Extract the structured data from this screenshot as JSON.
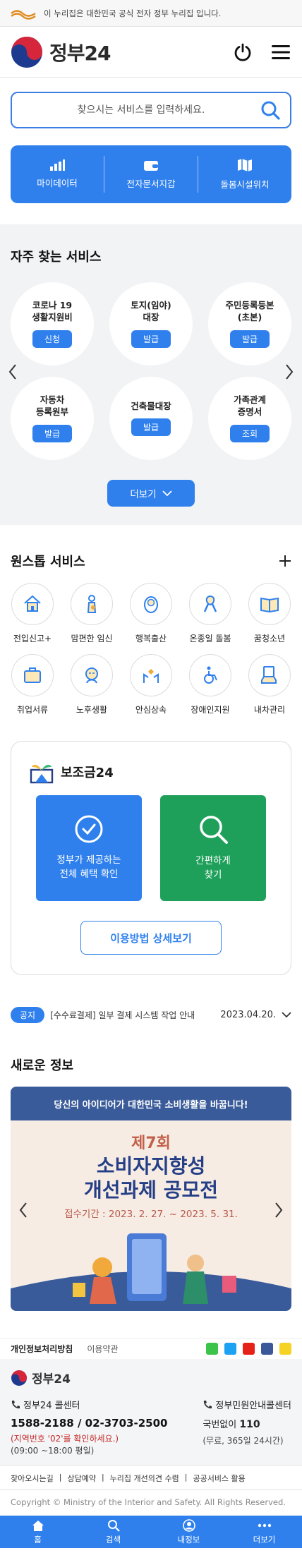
{
  "banner": {
    "text": "이 누리집은 대한민국 공식 전자 정부 누리집 입니다."
  },
  "header": {
    "logo_text": "정부24"
  },
  "search": {
    "placeholder": "찾으시는 서비스를 입력하세요."
  },
  "quick": [
    {
      "label": "마이데이터",
      "icon": "chart-icon"
    },
    {
      "label": "전자문서지갑",
      "icon": "wallet-icon"
    },
    {
      "label": "돌봄시설위치",
      "icon": "map-icon"
    }
  ],
  "frequent": {
    "title": "자주 찾는 서비스",
    "items": [
      {
        "name": "코로나 19\n생활지원비",
        "action": "신청"
      },
      {
        "name": "토지(임야)\n대장",
        "action": "발급"
      },
      {
        "name": "주민등록등본\n(초본)",
        "action": "발급"
      },
      {
        "name": "자동차\n등록원부",
        "action": "발급"
      },
      {
        "name": "건축물대장",
        "action": "발급"
      },
      {
        "name": "가족관계\n증명서",
        "action": "조회"
      }
    ],
    "more_label": "더보기"
  },
  "onestop": {
    "title": "원스톱 서비스",
    "items": [
      {
        "label": "전입신고+",
        "icon": "house-icon"
      },
      {
        "label": "맘편한 임신",
        "icon": "pregnancy-icon"
      },
      {
        "label": "행복출산",
        "icon": "baby-icon"
      },
      {
        "label": "온종일 돌봄",
        "icon": "ribbon-icon"
      },
      {
        "label": "꿈청소년",
        "icon": "book-icon"
      },
      {
        "label": "취업서류",
        "icon": "briefcase-icon"
      },
      {
        "label": "노후생활",
        "icon": "elder-icon"
      },
      {
        "label": "안심상속",
        "icon": "hands-icon"
      },
      {
        "label": "장애인지원",
        "icon": "wheelchair-icon"
      },
      {
        "label": "내차관리",
        "icon": "car-icon"
      }
    ]
  },
  "subsidy": {
    "title": "보조금24",
    "card1": "정부가 제공하는\n전체 혜택 확인",
    "card2": "간편하게\n찾기",
    "guide": "이용방법 상세보기"
  },
  "notice": {
    "badge": "공지",
    "text": "[수수료결제] 일부 결제 시스템 작업 안내",
    "date": "2023.04.20."
  },
  "news": {
    "title": "새로운 정보",
    "banner_top": "당신의 아이디어가 대한민국 소비생활을 바꿉니다!",
    "banner_small": "제7회",
    "banner_big": "소비자지향성\n개선과제 공모전",
    "banner_date": "접수기간 : 2023. 2. 27. ~ 2023. 5. 31."
  },
  "footer": {
    "privacy": "개인정보처리방침",
    "terms": "이용약관",
    "logo_text": "정부24",
    "call_center": "정부24 콜센터",
    "call_numbers": "1588-2188 / 02-3703-2500",
    "area_note": "(지역번호 '02'를 확인하세요.)",
    "hours": "(09:00 ~18:00 평일)",
    "info_center": "정부민원안내콜센터",
    "info_prefix": "국번없이",
    "info_number": "110",
    "info_hours": "(무료, 365일 24시간)",
    "links": [
      "찾아오시는길",
      "상담예약",
      "누리집 개선의견 수렴",
      "공공서비스 활용"
    ],
    "copyright": "Copyright © Ministry of the Interior and Safety. All Rights Reserved."
  },
  "tabs": [
    {
      "label": "홈",
      "icon": "home-icon"
    },
    {
      "label": "검색",
      "icon": "search-icon"
    },
    {
      "label": "내정보",
      "icon": "user-icon"
    },
    {
      "label": "더보기",
      "icon": "more-icon"
    }
  ],
  "colors": {
    "primary": "#2f80ed",
    "green": "#1ea05a",
    "navy": "#243f86"
  }
}
